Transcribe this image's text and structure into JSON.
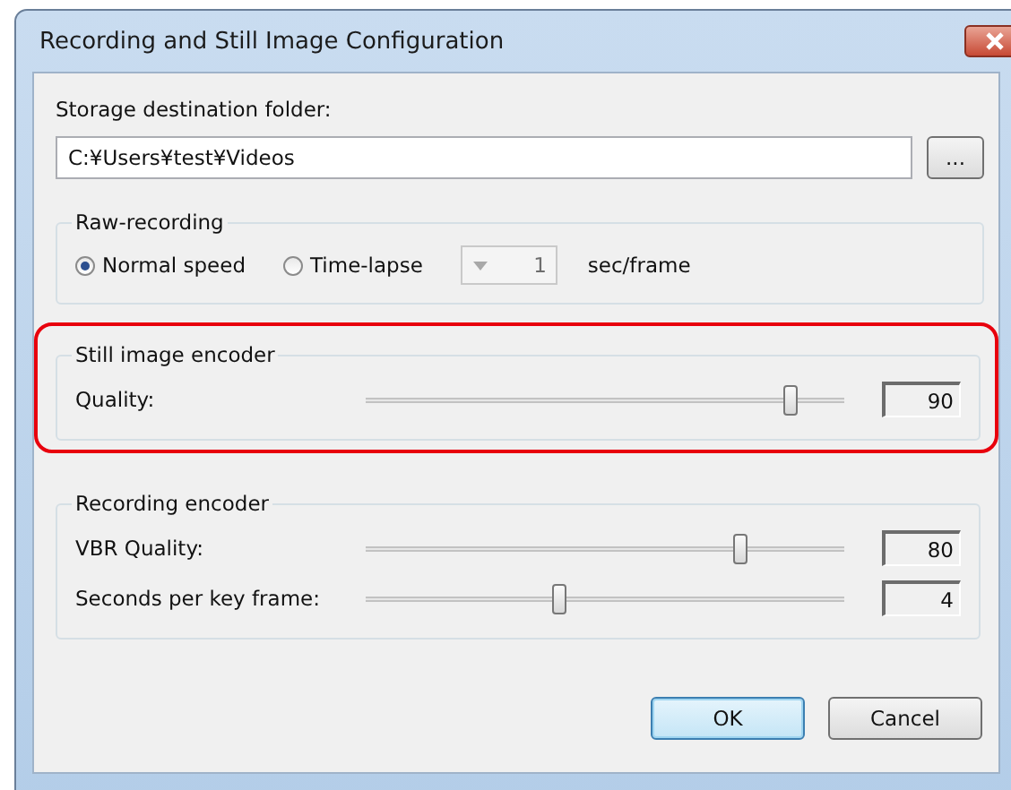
{
  "window": {
    "title": "Recording and Still Image Configuration"
  },
  "storage": {
    "label": "Storage destination folder:",
    "value": "C:¥Users¥test¥Videos",
    "browse_button": "..."
  },
  "raw_recording": {
    "title": "Raw-recording",
    "modes": [
      {
        "label": "Normal speed",
        "selected": true
      },
      {
        "label": "Time-lapse",
        "selected": false
      }
    ],
    "interval": {
      "value": "1",
      "disabled": true
    },
    "unit": "sec/frame"
  },
  "still_image_encoder": {
    "title": "Still image encoder",
    "highlighted": true,
    "settings": [
      {
        "label": "Quality:",
        "level": 0.9,
        "value": "90"
      }
    ]
  },
  "recording_encoder": {
    "title": "Recording encoder",
    "highlighted": false,
    "settings": [
      {
        "label": "VBR Quality:",
        "level": 0.79,
        "value": "80"
      },
      {
        "label": "Seconds per key frame:",
        "level": 0.4,
        "value": "4"
      }
    ]
  },
  "buttons": [
    {
      "label": "OK",
      "default": true
    },
    {
      "label": "Cancel",
      "default": false
    }
  ]
}
